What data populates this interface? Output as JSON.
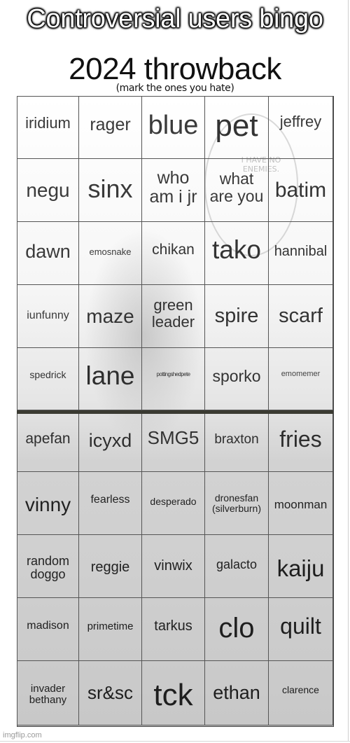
{
  "header": {
    "title": "Controversial users bingo",
    "subtitle": "2024 throwback",
    "note": "(mark the ones you hate)"
  },
  "background_image": {
    "description": "faded grayscale illustration of a hooded figure with a speech bubble",
    "bubble_text": "I HAVE NO ENEMIES."
  },
  "board": {
    "columns": 5,
    "rows": 10,
    "cells": [
      [
        "iridium",
        "rager",
        "blue",
        "pet",
        "jeffrey"
      ],
      [
        "negu",
        "sinx",
        "who am i jr",
        "what are you",
        "batim"
      ],
      [
        "dawn",
        "emosnake",
        "chikan",
        "tako",
        "hannibal"
      ],
      [
        "iunfunny",
        "maze",
        "green leader",
        "spire",
        "scarf"
      ],
      [
        "spedrick",
        "lane",
        "pottingshedpete",
        "sporko",
        "emomemer"
      ],
      [
        "apefan",
        "icyxd",
        "SMG5",
        "braxton",
        "fries"
      ],
      [
        "vinny",
        "fearless",
        "desperado",
        "dronesfan (silverburn)",
        "moonman"
      ],
      [
        "random doggo",
        "reggie",
        "vinwix",
        "galacto",
        "kaiju"
      ],
      [
        "madison",
        "primetime",
        "tarkus",
        "clo",
        "quilt"
      ],
      [
        "invader bethany",
        "sr&sc",
        "tck",
        "ethan",
        "clarence"
      ]
    ]
  },
  "footer": {
    "watermark": "imgflip.com"
  }
}
